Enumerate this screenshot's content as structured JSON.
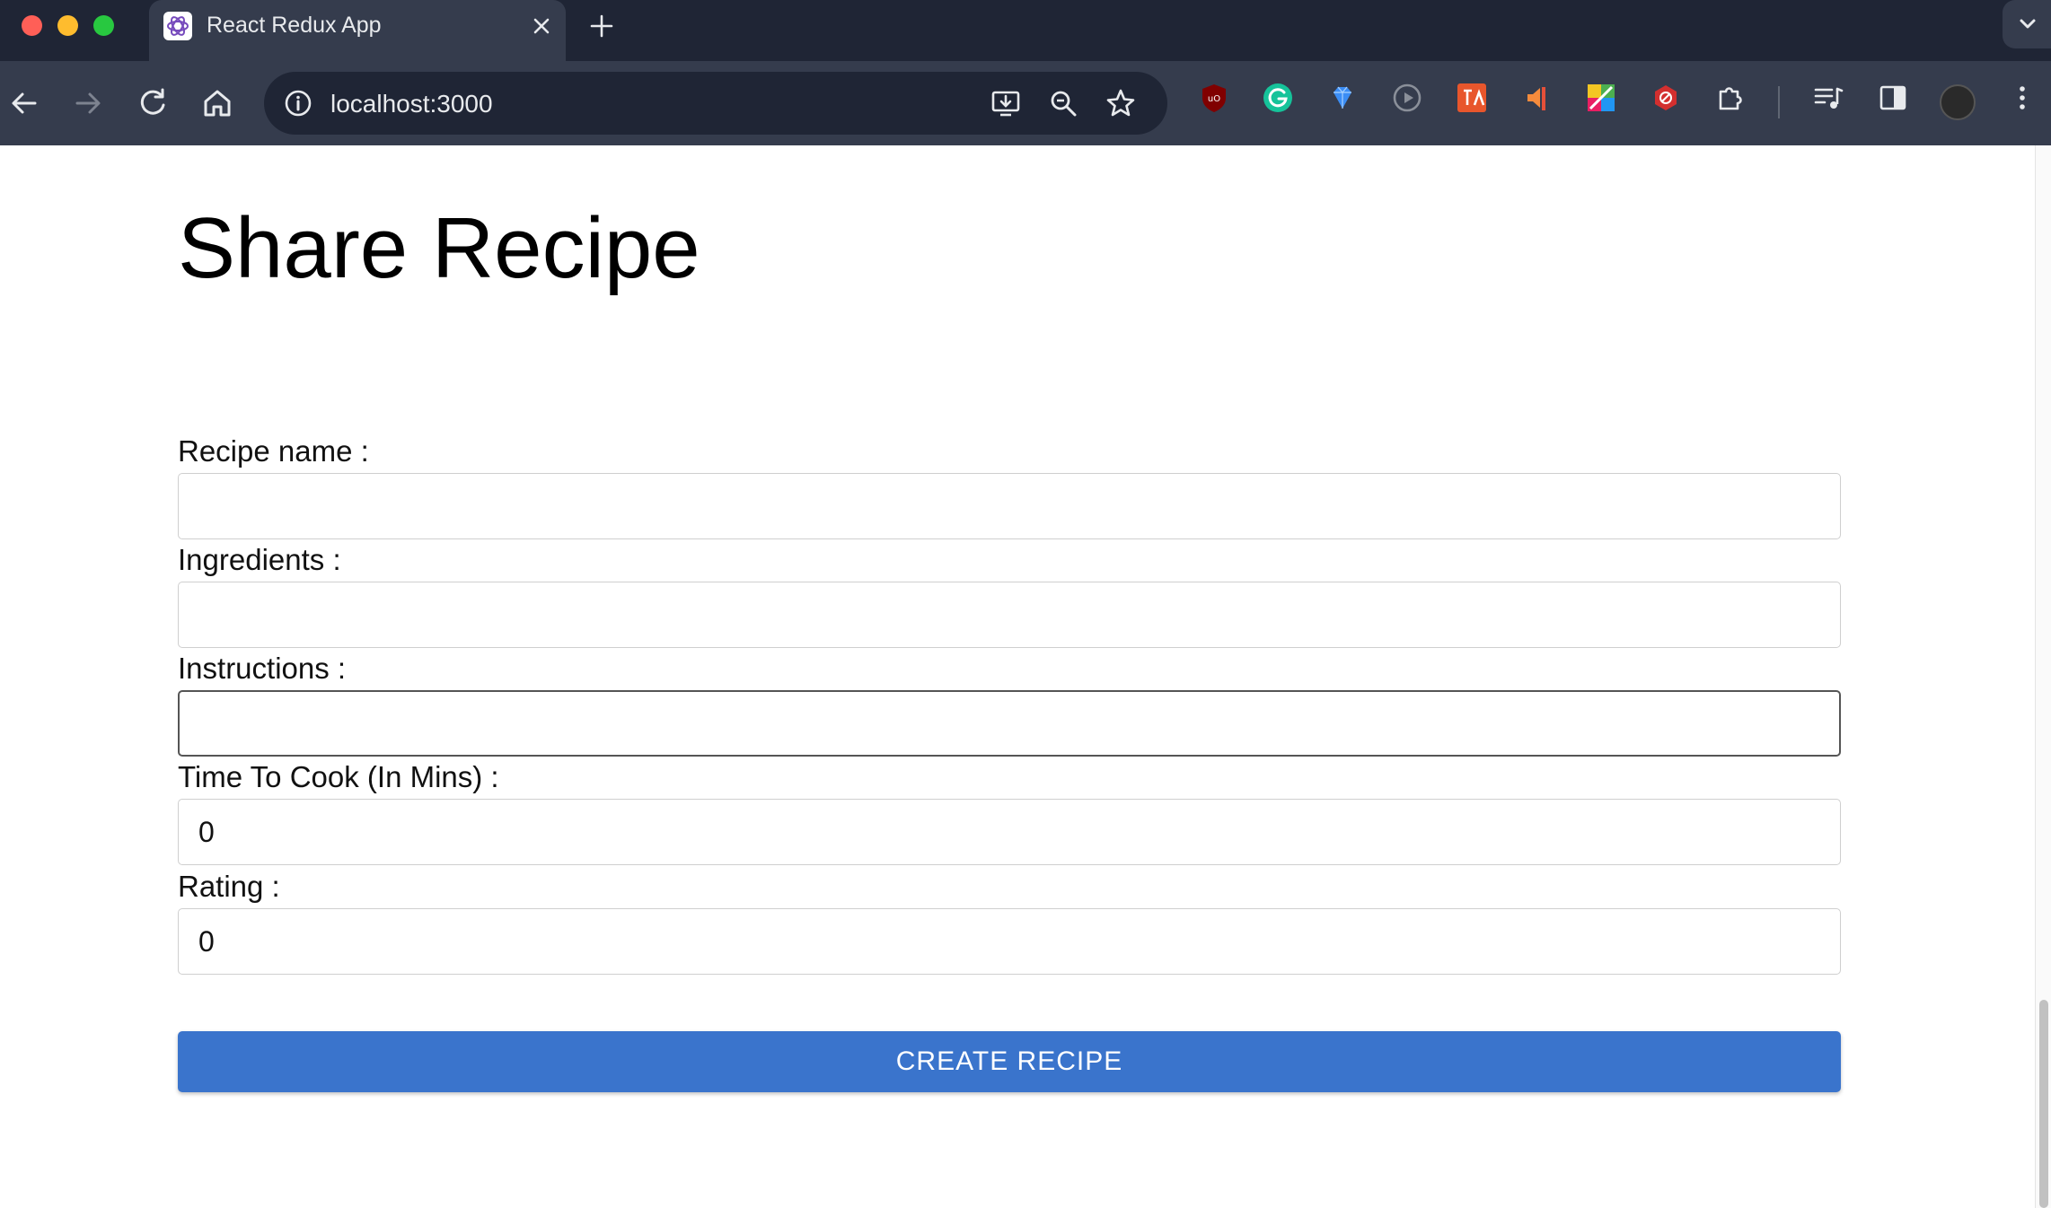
{
  "browser": {
    "tab_title": "React Redux App",
    "url": "localhost:3000"
  },
  "page": {
    "title": "Share Recipe",
    "fields": [
      {
        "label": "Recipe name :",
        "value": ""
      },
      {
        "label": "Ingredients :",
        "value": ""
      },
      {
        "label": "Instructions :",
        "value": ""
      },
      {
        "label": "Time To Cook (In Mins) :",
        "value": "0"
      },
      {
        "label": "Rating :",
        "value": "0"
      }
    ],
    "submit_label": "CREATE RECIPE"
  },
  "colors": {
    "chrome_dark": "#1f2535",
    "chrome_toolbar": "#353c4d",
    "button_primary": "#3a74cc"
  }
}
